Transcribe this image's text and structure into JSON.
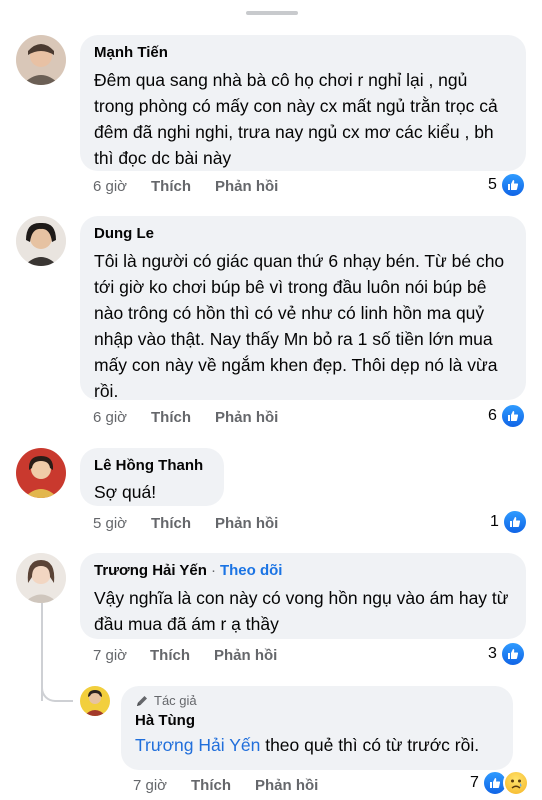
{
  "comments": [
    {
      "author": "Mạnh Tiến",
      "text": "Đêm qua sang nhà bà cô họ chơi r nghỉ lại , ngủ trong phòng có mấy con này cx mất ngủ trằn trọc cả đêm đã nghi nghi, trưa nay ngủ cx mơ các kiểu , bh thì đọc dc bài này",
      "time": "6 giờ",
      "like_label": "Thích",
      "reply_label": "Phản hồi",
      "reaction_count": "5"
    },
    {
      "author": "Dung Le",
      "text": "Tôi là người có giác quan thứ 6 nhạy bén. Từ bé cho tới giờ ko chơi búp bê vì trong đầu luôn nói búp bê nào trông có hồn thì có vẻ như có linh hồn ma quỷ nhập vào thật. Nay thấy Mn bỏ ra 1 số tiền lớn mua mấy con này về ngắm khen đẹp. Thôi dẹp nó là vừa rồi.",
      "time": "6 giờ",
      "like_label": "Thích",
      "reply_label": "Phản hồi",
      "reaction_count": "6"
    },
    {
      "author": "Lê Hồng Thanh",
      "text": "Sợ quá!",
      "time": "5 giờ",
      "like_label": "Thích",
      "reply_label": "Phản hồi",
      "reaction_count": "1"
    },
    {
      "author": "Trương Hải Yến",
      "follow_separator": "·",
      "follow_label": "Theo dõi",
      "text": "Vậy nghĩa là con này có vong hồn ngụ vào ám hay từ đầu mua đã ám r ạ thầy",
      "time": "7 giờ",
      "like_label": "Thích",
      "reply_label": "Phản hồi",
      "reaction_count": "3"
    }
  ],
  "reply": {
    "badge": "Tác giả",
    "author": "Hà Tùng",
    "mention": "Trương Hải Yến",
    "text": " theo quẻ thì có từ trước rồi.",
    "time": "7 giờ",
    "like_label": "Thích",
    "reply_label": "Phản hồi",
    "reaction_count": "7"
  },
  "colors": {
    "bubble": "#f0f2f5",
    "link": "#1b74e4",
    "secondary_text": "#65676b"
  },
  "icons": [
    "like-icon",
    "sad-icon",
    "pen-icon"
  ]
}
